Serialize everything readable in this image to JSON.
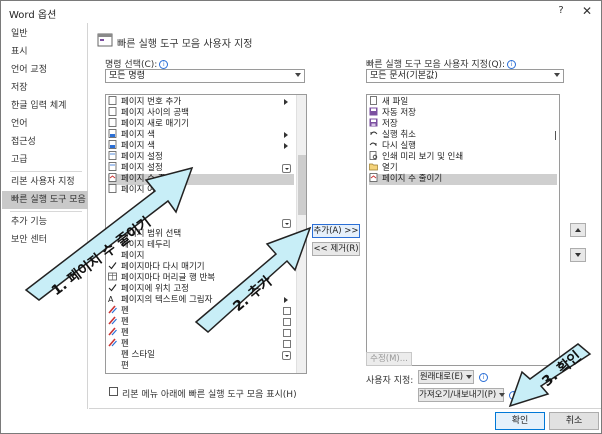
{
  "window": {
    "title": "Word 옵션",
    "help_label": "?",
    "close_label": "✕"
  },
  "sidebar": {
    "items": [
      {
        "label": "일반"
      },
      {
        "label": "표시"
      },
      {
        "label": "언어 교정"
      },
      {
        "label": "저장"
      },
      {
        "label": "한글 입력 체계"
      },
      {
        "label": "언어"
      },
      {
        "label": "접근성"
      },
      {
        "label": "고급"
      },
      {
        "label": "리본 사용자 지정"
      },
      {
        "label": "빠른 실행 도구 모음"
      },
      {
        "label": "추가 기능"
      },
      {
        "label": "보안 센터"
      }
    ],
    "selected_index": 9
  },
  "main": {
    "section_title": "빠른 실행 도구 모음 사용자 지정",
    "left_label": "명령 선택(C):",
    "left_combo_value": "모든 명령",
    "right_label": "빠른 실행 도구 모음 사용자 지정(Q):",
    "right_combo_value": "모든 문서(기본값)",
    "commands": [
      {
        "label": "페이지 번호 추가",
        "icon": "page-icon",
        "suffix": "arrow"
      },
      {
        "label": "페이지 사이의 공백",
        "icon": "page-icon",
        "suffix": ""
      },
      {
        "label": "페이지 새로 매기기",
        "icon": "page-icon",
        "suffix": ""
      },
      {
        "label": "페이지 색",
        "icon": "page-color-icon",
        "suffix": "arrow"
      },
      {
        "label": "페이지 색",
        "icon": "page-color-icon",
        "suffix": "arrow"
      },
      {
        "label": "페이지 설정",
        "icon": "page-setup-icon",
        "suffix": ""
      },
      {
        "label": "페이지 설정",
        "icon": "page-setup-icon",
        "suffix": "dropdown"
      },
      {
        "label": "페이지 수 줄이기",
        "icon": "shrink-page-icon",
        "suffix": ""
      },
      {
        "label": "페이지 여백",
        "icon": "page-icon",
        "suffix": ""
      },
      {
        "label": "",
        "icon": "",
        "suffix": ""
      },
      {
        "label": "",
        "icon": "",
        "suffix": ""
      },
      {
        "label": "",
        "icon": "",
        "suffix": "dropdown"
      },
      {
        "label": "페이지 범위 선택",
        "icon": "",
        "suffix": ""
      },
      {
        "label": "페이지 테두리",
        "icon": "",
        "suffix": ""
      },
      {
        "label": "페이지",
        "icon": "",
        "suffix": ""
      },
      {
        "label": "페이지마다 다시 매기기",
        "icon": "check-icon",
        "suffix": ""
      },
      {
        "label": "페이지마다 머리글 행 반복",
        "icon": "table-icon",
        "suffix": ""
      },
      {
        "label": "페이지에 위치 고정",
        "icon": "check-icon",
        "suffix": ""
      },
      {
        "label": "페이지의 텍스트에 그림자",
        "icon": "text-shadow-icon",
        "suffix": "arrow"
      },
      {
        "label": "펜",
        "icon": "pen-icon",
        "suffix": "checkbox"
      },
      {
        "label": "펜",
        "icon": "pen-icon",
        "suffix": "checkbox"
      },
      {
        "label": "펜",
        "icon": "pen-icon",
        "suffix": "checkbox"
      },
      {
        "label": "펜",
        "icon": "pen-icon",
        "suffix": "checkbox"
      },
      {
        "label": "펜 스타일",
        "icon": "",
        "suffix": "dropdown"
      },
      {
        "label": "편",
        "icon": "",
        "suffix": ""
      }
    ],
    "selected_command_index": 7,
    "add_button": "추가(A) >>",
    "remove_button": "<< 제거(R)",
    "toolbar_items": [
      {
        "label": "새 파일",
        "icon": "new-file-icon"
      },
      {
        "label": "자동 저장",
        "icon": "autosave-icon"
      },
      {
        "label": "저장",
        "icon": "save-icon"
      },
      {
        "label": "실행 취소",
        "icon": "undo-icon"
      },
      {
        "label": "다시 실행",
        "icon": "redo-icon"
      },
      {
        "label": "인쇄 미리 보기 및 인쇄",
        "icon": "print-preview-icon"
      },
      {
        "label": "열기",
        "icon": "open-icon"
      },
      {
        "label": "페이지 수 줄이기",
        "icon": "shrink-page-icon"
      }
    ],
    "selected_toolbar_index": 7,
    "modify_button": "수정(M)...",
    "custom_label": "사용자 지정:",
    "reset_button": "원래대로(E)",
    "import_export_button": "가져오기/내보내기(P)",
    "show_below_ribbon_label": "리본 메뉴 아래에 빠른 실행 도구 모음 표시(H)"
  },
  "footer": {
    "ok_button": "확인",
    "cancel_button": "취소"
  },
  "annotations": {
    "step1": "1. 페이지 수 줄이기",
    "step2": "2. 추가",
    "step3": "3. 확인"
  },
  "colors": {
    "arrow_fill": "#c8eef7",
    "arrow_stroke": "#222222",
    "selection": "#cfcfcf",
    "focus_border": "#2b6fd6"
  }
}
